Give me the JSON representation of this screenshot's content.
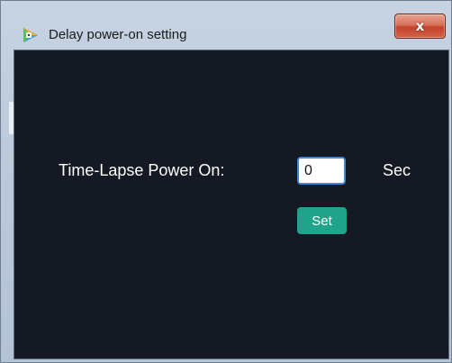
{
  "window": {
    "title": "Delay power-on setting",
    "close_glyph": "x",
    "app_icon": "app-logo-icon"
  },
  "form": {
    "label": "Time-Lapse Power On:",
    "value": "0",
    "unit": "Sec",
    "set_label": "Set"
  },
  "colors": {
    "client_background": "#141923",
    "set_button": "#1fa38b",
    "input_border": "#3b86d6",
    "close_button": "#c3442a"
  }
}
